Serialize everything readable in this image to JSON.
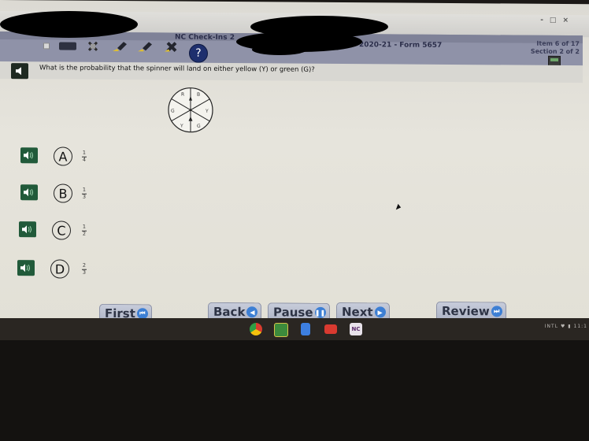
{
  "window": {
    "controls": [
      "-",
      "□",
      "×"
    ]
  },
  "header": {
    "app_title": "NC Check-Ins 2",
    "form_label": "2020-21 - Form 5657",
    "item_progress": "Item 6 of 17",
    "section_progress": "Section 2 of 2",
    "tools": [
      {
        "icon": "flag-checkbox-icon"
      },
      {
        "icon": "masking-icon"
      },
      {
        "icon": "eliminate-answer-icon"
      },
      {
        "icon": "highlighter-icon"
      },
      {
        "icon": "highlighter-icon"
      },
      {
        "icon": "eraser-icon"
      },
      {
        "icon": "help-icon",
        "label": "?"
      }
    ],
    "calculator_icon": "calculator-icon"
  },
  "question": {
    "text": "What is the probability that the spinner will land on either yellow (Y) or green (G)?",
    "spinner_sections": [
      "R",
      "B",
      "Y",
      "G",
      "Y",
      "G"
    ]
  },
  "choices": [
    {
      "letter": "A",
      "numerator": "1",
      "denominator": "4"
    },
    {
      "letter": "B",
      "numerator": "1",
      "denominator": "3"
    },
    {
      "letter": "C",
      "numerator": "1",
      "denominator": "2"
    },
    {
      "letter": "D",
      "numerator": "2",
      "denominator": "3"
    }
  ],
  "navigation": {
    "first": "First",
    "back": "Back",
    "pause": "Pause",
    "next": "Next",
    "review": "Review"
  },
  "taskbar": {
    "apps": [
      "chrome",
      "google-classroom",
      "google-docs",
      "youtube",
      "nc-app"
    ],
    "tray_text": "INTL",
    "time": "11:1"
  }
}
